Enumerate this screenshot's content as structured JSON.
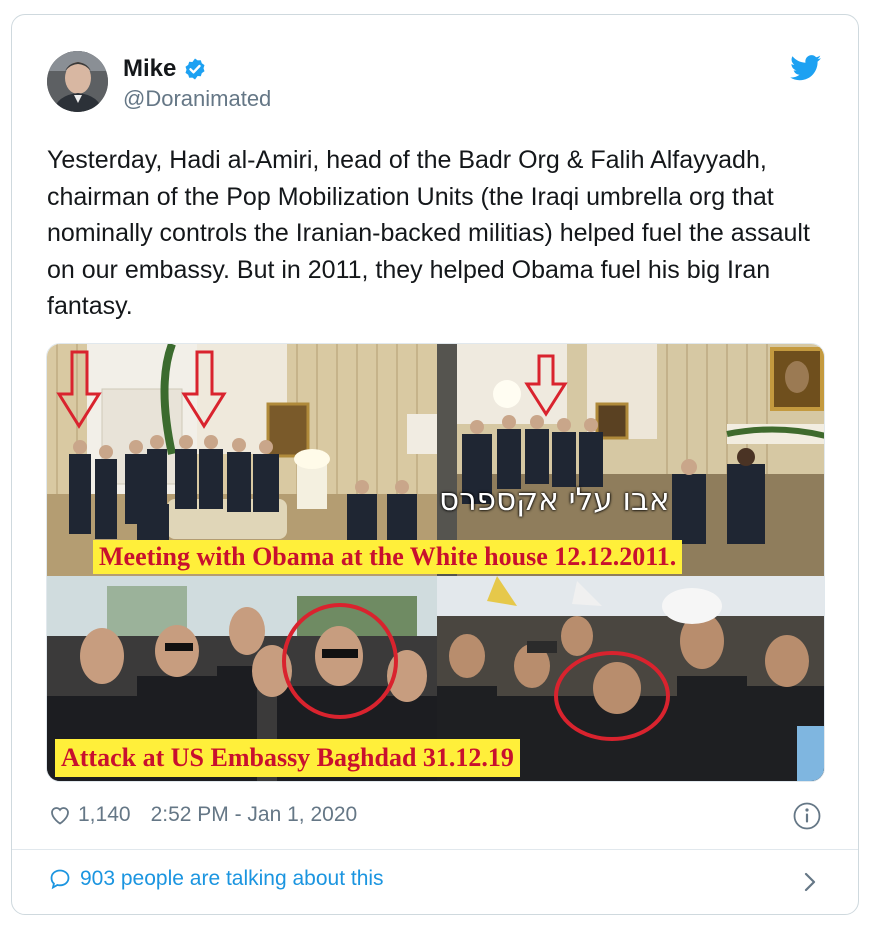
{
  "author": {
    "name": "Mike",
    "handle": "@Doranimated",
    "verified": true
  },
  "tweet": {
    "text": "Yesterday, Hadi al-Amiri, head of the Badr Org & Falih Alfayyadh, chairman of the Pop Mobilization Units (the Iraqi umbrella org that nominally controls the Iranian-backed militias) helped fuel the assault on our embassy. But in 2011, they helped Obama fuel his big Iran fantasy."
  },
  "media": {
    "caption_top": "Meeting with Obama at the White house 12.12.2011.",
    "caption_bottom": "Attack at US Embassy Baghdad 31.12.19",
    "hebrew_overlay": "אבו עלי אקספרס"
  },
  "meta": {
    "likes": "1,140",
    "timestamp": "2:52 PM - Jan 1, 2020"
  },
  "footer": {
    "conversation": "903 people are talking about this"
  },
  "colors": {
    "accent": "#1da1f2",
    "link": "#1b95e0",
    "muted": "#657786",
    "caption_bg": "#ffef3a",
    "caption_text": "#c8102e",
    "highlight": "#d9232e"
  },
  "icons": [
    "verified-badge-icon",
    "twitter-bird-icon",
    "heart-icon",
    "info-icon",
    "speech-bubble-icon",
    "chevron-right-icon"
  ]
}
